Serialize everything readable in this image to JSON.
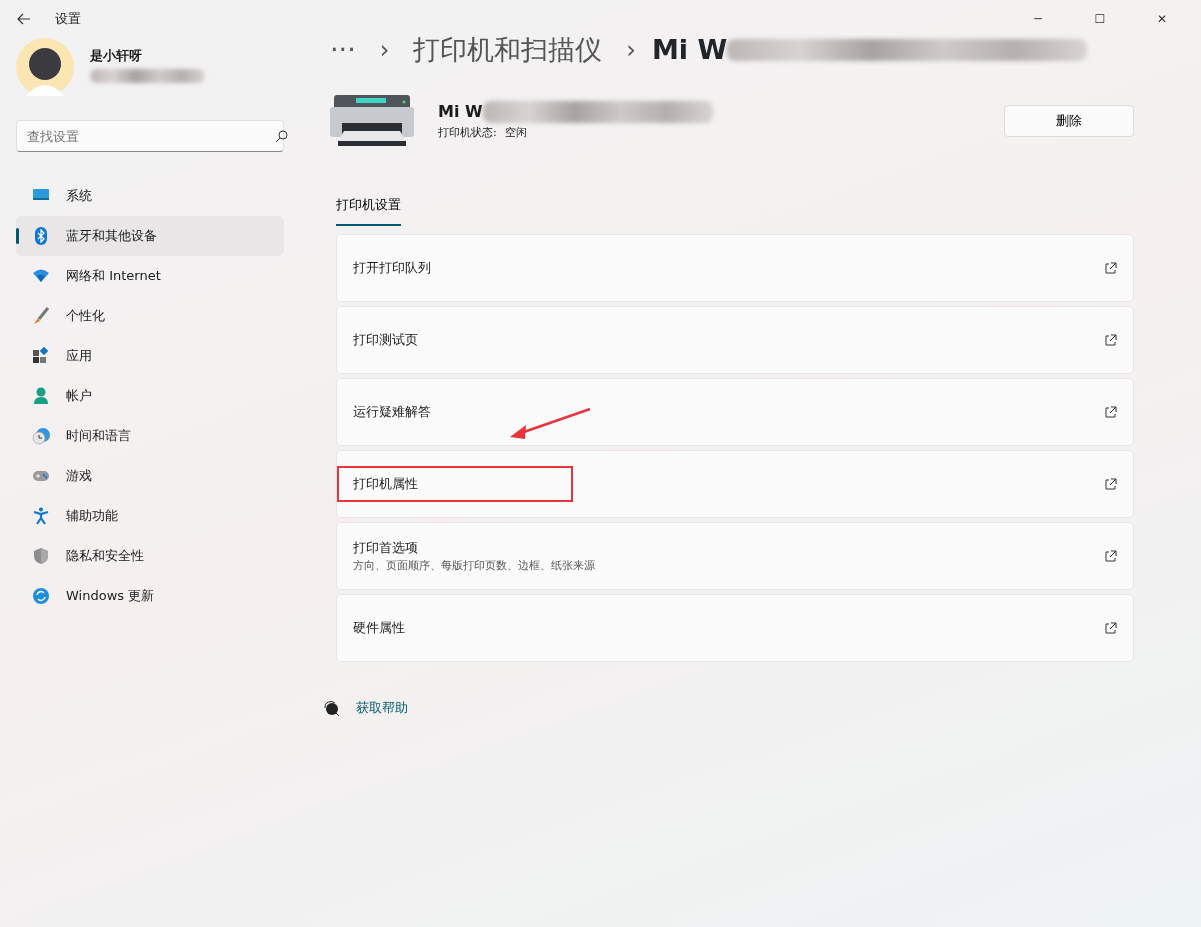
{
  "window": {
    "title": "设置",
    "controls": [
      "─",
      "☐",
      "✕"
    ]
  },
  "user": {
    "name": "是小轩呀"
  },
  "search": {
    "placeholder": "查找设置"
  },
  "sidebar": {
    "items": [
      {
        "label": "系统",
        "selected": false
      },
      {
        "label": "蓝牙和其他设备",
        "selected": true
      },
      {
        "label": "网络和 Internet",
        "selected": false
      },
      {
        "label": "个性化",
        "selected": false
      },
      {
        "label": "应用",
        "selected": false
      },
      {
        "label": "帐户",
        "selected": false
      },
      {
        "label": "时间和语言",
        "selected": false
      },
      {
        "label": "游戏",
        "selected": false
      },
      {
        "label": "辅助功能",
        "selected": false
      },
      {
        "label": "隐私和安全性",
        "selected": false
      },
      {
        "label": "Windows 更新",
        "selected": false
      }
    ]
  },
  "breadcrumb": {
    "more": "···",
    "separators": [
      "›",
      "›"
    ],
    "parent": "打印机和扫描仪",
    "current": "Mi W"
  },
  "printer": {
    "name": "Mi W",
    "status_label": "打印机状态:",
    "status": "空闲",
    "delete_button": "删除"
  },
  "section": {
    "tab": "打印机设置",
    "selected": true
  },
  "settings": [
    {
      "title": "打开打印队列",
      "highlighted": false
    },
    {
      "title": "打印测试页",
      "highlighted": false
    },
    {
      "title": "运行疑难解答",
      "highlighted": false
    },
    {
      "title": "打印机属性",
      "highlighted": true
    },
    {
      "title": "打印首选项",
      "subtitle": "方向、页面顺序、每版打印页数、边框、纸张来源",
      "highlighted": false
    },
    {
      "title": "硬件属性",
      "highlighted": false
    }
  ],
  "help": {
    "label": "获取帮助"
  }
}
